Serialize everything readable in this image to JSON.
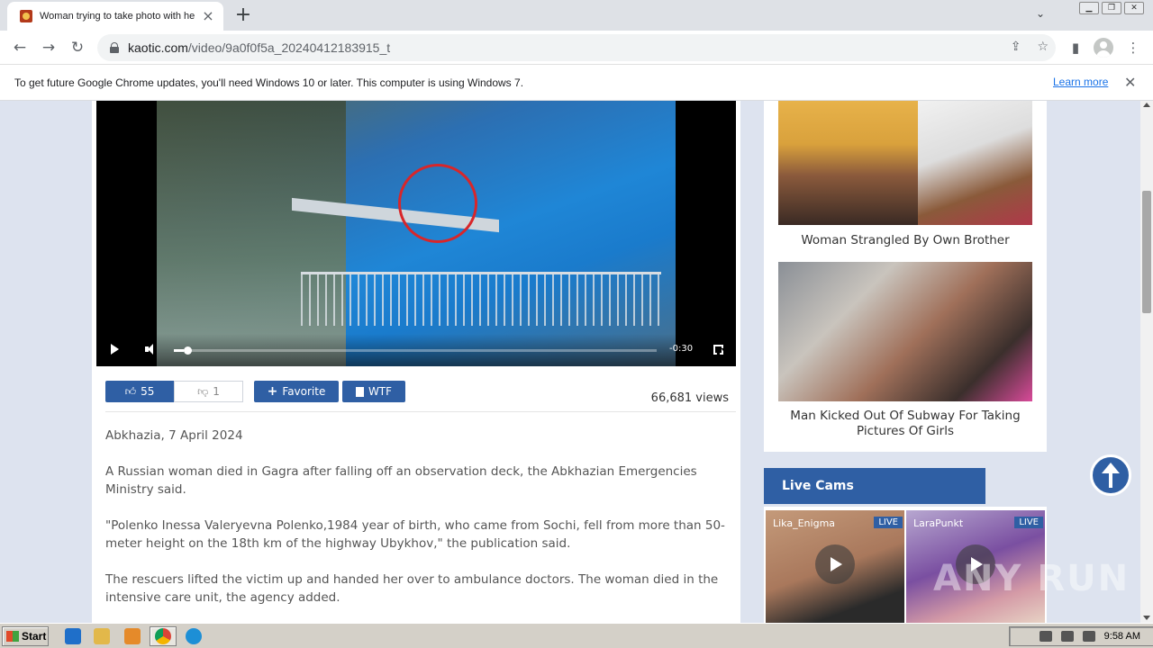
{
  "browser": {
    "tab_title": "Woman trying to take photo with he",
    "url_domain": "kaotic.com",
    "url_path": "/video/9a0f0f5a_20240412183915_t",
    "infobar_text": "To get future Google Chrome updates, you'll need Windows 10 or later. This computer is using Windows 7.",
    "infobar_link": "Learn more"
  },
  "video": {
    "time_remaining": "-0:30",
    "progress_fraction": 0.02
  },
  "actions": {
    "likes": "55",
    "dislikes": "1",
    "favorite_label": "Favorite",
    "wtf_label": "WTF",
    "views": "66,681 views"
  },
  "article": {
    "paragraphs": [
      "Abkhazia, 7 April 2024",
      "A Russian woman died in Gagra after falling off an observation deck, the Abkhazian Emergencies Ministry said.",
      "\"Polenko Inessa Valeryevna Polenko,1984 year of birth, who came from Sochi, fell from more than 50-meter height on the 18th km of the highway Ubykhov,\" the publication said.",
      "The rescuers lifted the victim up and handed her over to ambulance doctors. The woman died in the intensive care unit, the agency added."
    ]
  },
  "sidebar": {
    "items": [
      {
        "caption": "Woman Strangled By Own Brother"
      },
      {
        "caption": "Man Kicked Out Of Subway For Taking Pictures Of Girls"
      }
    ]
  },
  "livecams": {
    "title": "Live Cams",
    "cams": [
      {
        "name": "Lika_Enigma",
        "badge": "LIVE"
      },
      {
        "name": "LaraPunkt",
        "badge": "LIVE"
      }
    ]
  },
  "watermark": "ANY RUN",
  "taskbar": {
    "start_label": "Start",
    "clock": "9:58 AM"
  },
  "colors": {
    "accent": "#2f5fa4",
    "page_bg": "#dde3ef"
  }
}
